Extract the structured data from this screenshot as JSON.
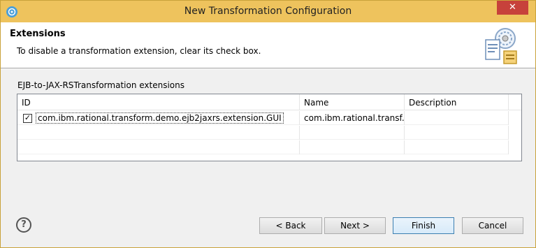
{
  "window": {
    "title": "New Transformation Configuration",
    "close_label": "✕"
  },
  "banner": {
    "title": "Extensions",
    "description": "To disable a transformation extension, clear its check box."
  },
  "extensions": {
    "label": "EJB-to-JAX-RSTransformation extensions",
    "columns": [
      "ID",
      "Name",
      "Description"
    ],
    "rows": [
      {
        "checked": true,
        "id": "com.ibm.rational.transform.demo.ejb2jaxrs.extension.GUI",
        "name": "com.ibm.rational.transf...",
        "description": ""
      }
    ]
  },
  "footer": {
    "help": "?",
    "back": "< Back",
    "next": "Next >",
    "finish": "Finish",
    "cancel": "Cancel"
  }
}
